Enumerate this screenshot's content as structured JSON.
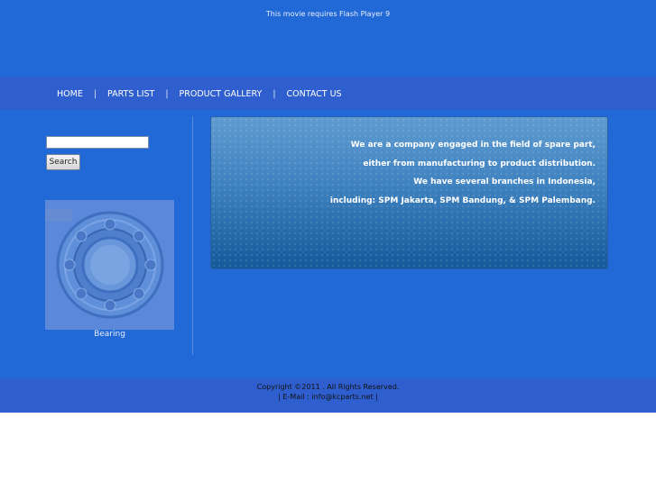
{
  "flash_notice": "This movie requires Flash Player 9",
  "nav": {
    "items": [
      {
        "label": "HOME"
      },
      {
        "label": "PARTS LIST"
      },
      {
        "label": "PRODUCT GALLERY"
      },
      {
        "label": "CONTACT US"
      }
    ],
    "separator": "|"
  },
  "search": {
    "value": "",
    "placeholder": "",
    "button_label": "Search"
  },
  "product": {
    "caption": "Bearing",
    "image_icon": "bearing-image"
  },
  "intro": {
    "lines": [
      "We are a company engaged in the field of spare part,",
      "either from manufacturing to product distribution.",
      "We have several branches in Indonesia,",
      "including: SPM Jakarta, SPM Bandung, & SPM Palembang."
    ]
  },
  "footer": {
    "copyright": "Copyright ©2011 . All Rights Reserved.",
    "email": "| E-Mail : info@kcparts.net |"
  },
  "colors": {
    "page_background": "#2269d8",
    "bar_background": "#2f5fcf",
    "info_box_top": "#5f9bd0",
    "info_box_bottom": "#145a9a"
  }
}
